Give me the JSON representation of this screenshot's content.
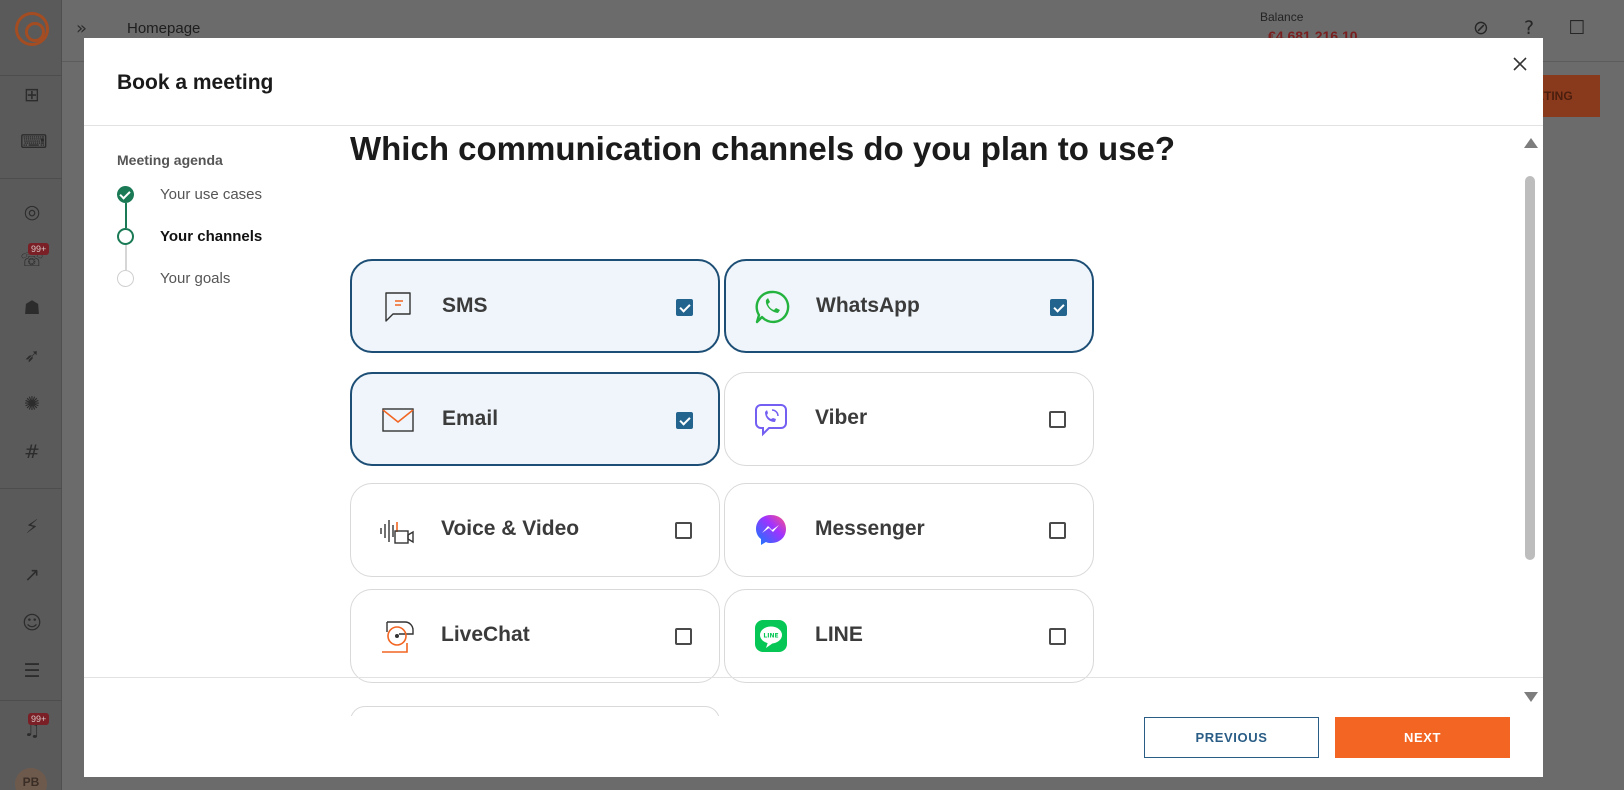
{
  "app": {
    "breadcrumb": "Homepage",
    "balance_label": "Balance",
    "balance_value": "€4,681,216.10",
    "bg_button_label": "ETING",
    "rail_badges": [
      "99+",
      "99+"
    ],
    "avatar_initials": "PB"
  },
  "modal": {
    "title": "Book a meeting",
    "agenda": {
      "title": "Meeting agenda",
      "steps": [
        {
          "label": "Your use cases",
          "status": "done"
        },
        {
          "label": "Your channels",
          "status": "current"
        },
        {
          "label": "Your goals",
          "status": "todo"
        }
      ]
    },
    "question": "Which communication channels do you plan to use?",
    "channels": [
      {
        "label": "SMS",
        "icon": "sms-icon",
        "checked": true
      },
      {
        "label": "WhatsApp",
        "icon": "whatsapp-icon",
        "checked": true
      },
      {
        "label": "Email",
        "icon": "email-icon",
        "checked": true
      },
      {
        "label": "Viber",
        "icon": "viber-icon",
        "checked": false
      },
      {
        "label": "Voice & Video",
        "icon": "voice-video-icon",
        "checked": false
      },
      {
        "label": "Messenger",
        "icon": "messenger-icon",
        "checked": false
      },
      {
        "label": "LiveChat",
        "icon": "livechat-icon",
        "checked": false
      },
      {
        "label": "LINE",
        "icon": "line-icon",
        "checked": false
      }
    ],
    "footer": {
      "previous_label": "PREVIOUS",
      "next_label": "NEXT"
    }
  },
  "colors": {
    "accent": "#f26522",
    "selected_border": "#1d4e75",
    "checkbox_checked": "#23648f",
    "step_done": "#1a7a55"
  }
}
